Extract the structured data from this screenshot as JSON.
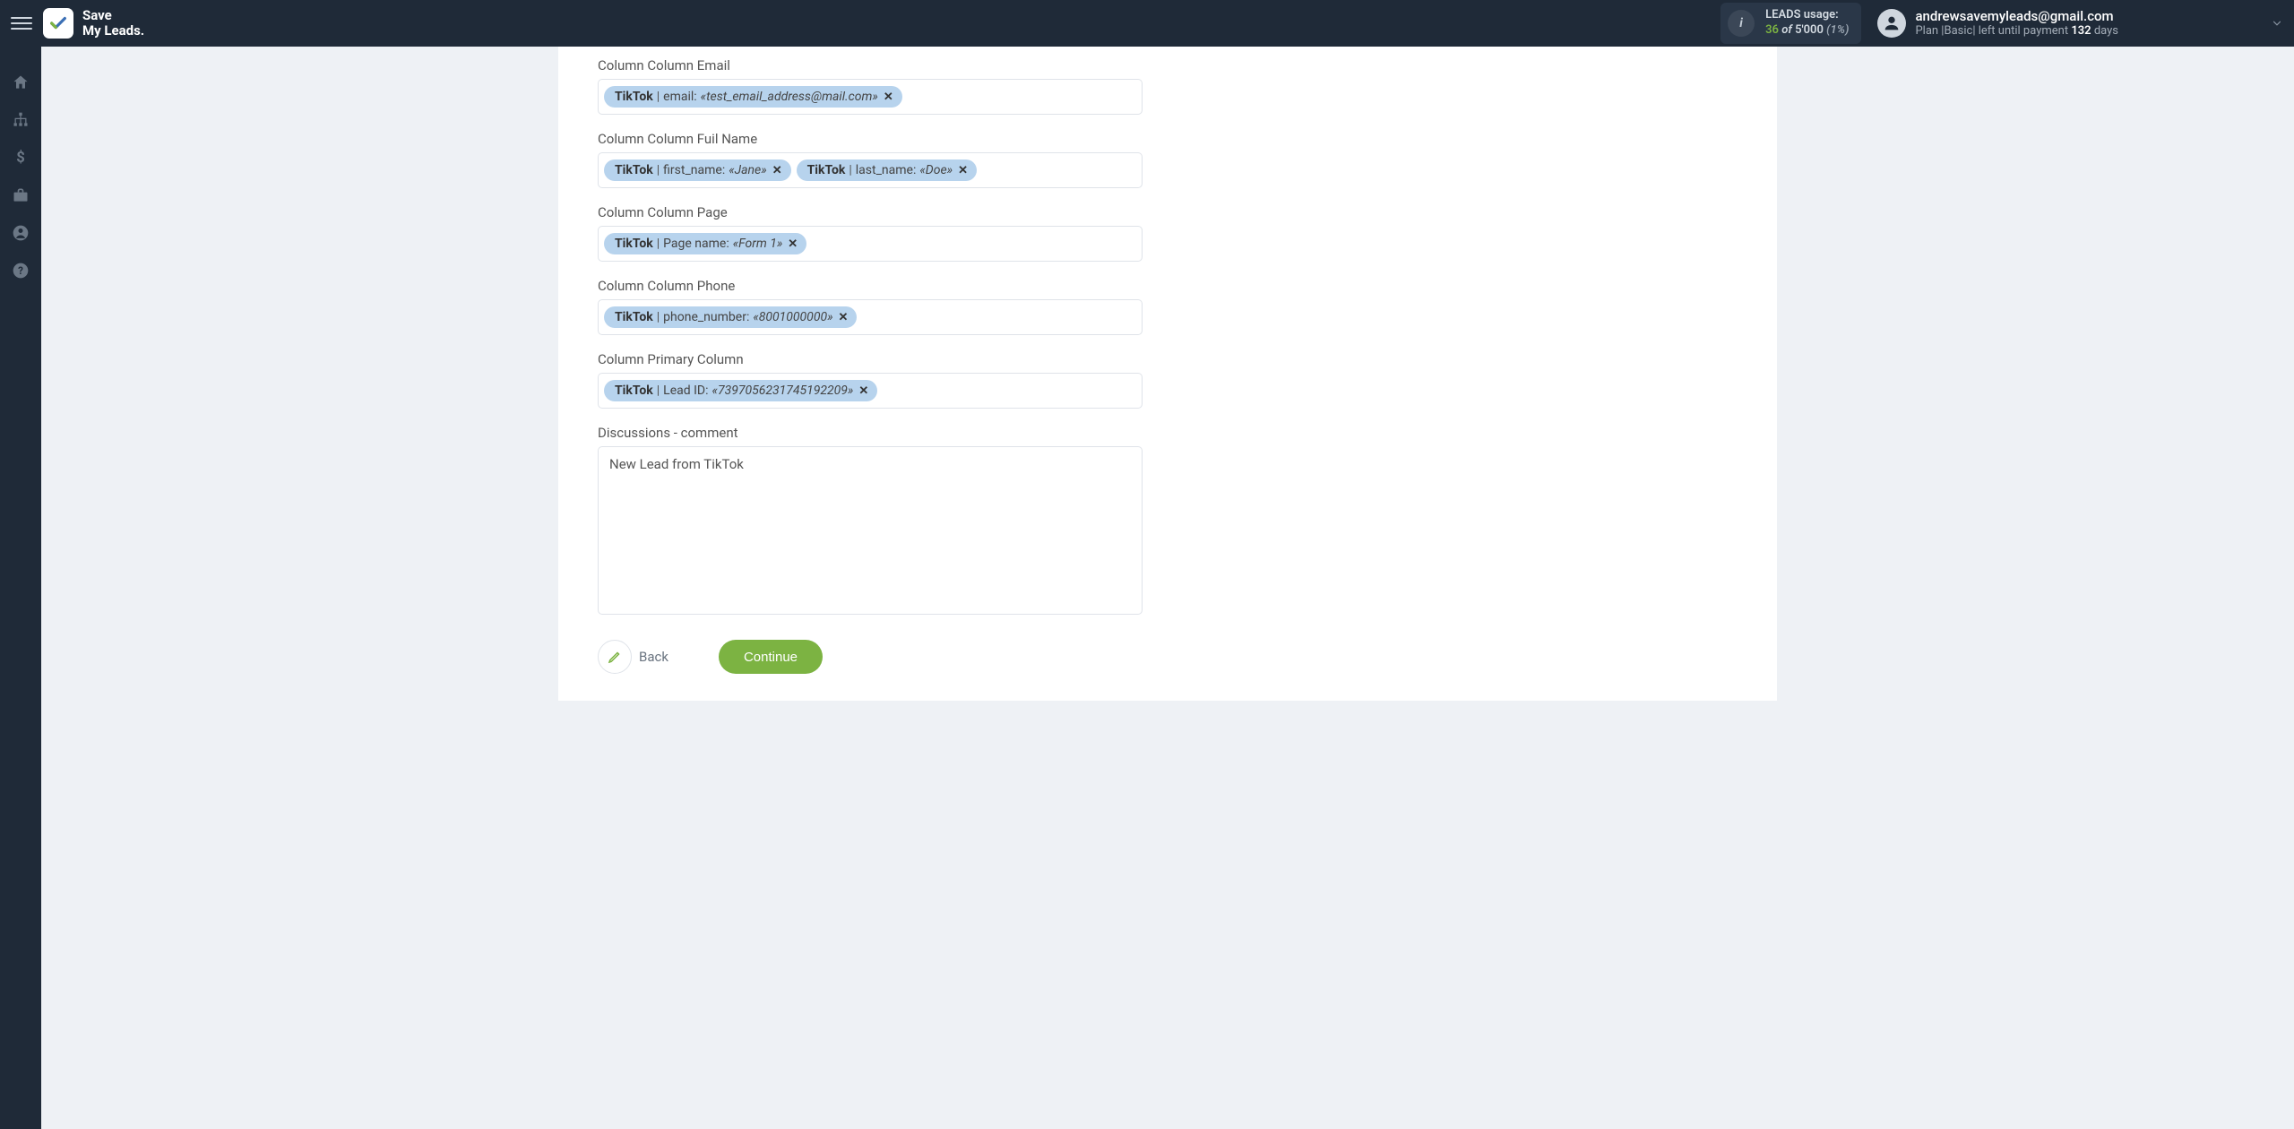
{
  "header": {
    "logo_text": "Save\nMy Leads.",
    "usage": {
      "label": "LEADS usage:",
      "count": "36",
      "of_word": "of",
      "total": "5'000",
      "pct": "(1%)"
    },
    "user": {
      "email": "andrewsavemyleads@gmail.com",
      "plan_prefix": "Plan |",
      "plan_name": "Basic",
      "plan_mid": "| left until payment ",
      "days": "132",
      "days_suffix": " days"
    }
  },
  "fields": [
    {
      "label": "Column Column Email",
      "chips": [
        {
          "source": "TikTok",
          "field": "email:",
          "value": "«test_email_address@mail.com»"
        }
      ]
    },
    {
      "label": "Column Column Fuil Name",
      "chips": [
        {
          "source": "TikTok",
          "field": "first_name:",
          "value": "«Jane»"
        },
        {
          "source": "TikTok",
          "field": "last_name:",
          "value": "«Doe»"
        }
      ]
    },
    {
      "label": "Column Column Page",
      "chips": [
        {
          "source": "TikTok",
          "field": "Page name:",
          "value": "«Form 1»"
        }
      ]
    },
    {
      "label": "Column Column Phone",
      "chips": [
        {
          "source": "TikTok",
          "field": "phone_number:",
          "value": "«8001000000»"
        }
      ]
    },
    {
      "label": "Column Primary Column",
      "chips": [
        {
          "source": "TikTok",
          "field": "Lead ID:",
          "value": "«7397056231745192209»"
        }
      ]
    }
  ],
  "discussion": {
    "label": "Discussions - comment",
    "value": "New Lead from TikTok"
  },
  "buttons": {
    "back": "Back",
    "continue": "Continue"
  }
}
